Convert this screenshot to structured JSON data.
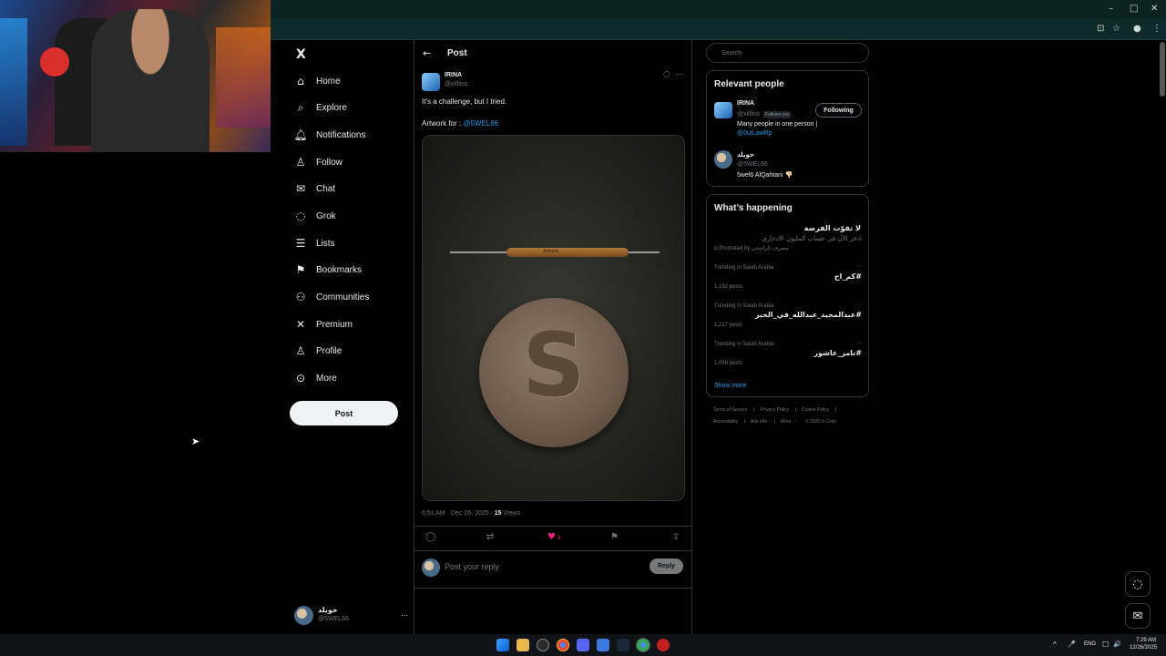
{
  "browser": {
    "window_controls": [
      "–",
      "□",
      "✕"
    ],
    "toolbar_icons": [
      "install-icon",
      "star-icon",
      "profile-icon",
      "menu-icon"
    ]
  },
  "webcam": {
    "logo_text": ""
  },
  "sidebar": {
    "logo": "X",
    "items": [
      {
        "label": "Home",
        "icon": "home-icon",
        "glyph": "⌂"
      },
      {
        "label": "Explore",
        "icon": "search-icon",
        "glyph": "⌕"
      },
      {
        "label": "Notifications",
        "icon": "bell-icon",
        "glyph": "♫"
      },
      {
        "label": "Follow",
        "icon": "add-person-icon",
        "glyph": "♙"
      },
      {
        "label": "Chat",
        "icon": "mail-icon",
        "glyph": "✉"
      },
      {
        "label": "Grok",
        "icon": "grok-icon",
        "glyph": "◌"
      },
      {
        "label": "Lists",
        "icon": "list-icon",
        "glyph": "☰"
      },
      {
        "label": "Bookmarks",
        "icon": "bookmark-icon",
        "glyph": "⚑"
      },
      {
        "label": "Communities",
        "icon": "communities-icon",
        "glyph": "⚇"
      },
      {
        "label": "Premium",
        "icon": "x-icon",
        "glyph": "✕"
      },
      {
        "label": "Profile",
        "icon": "person-icon",
        "glyph": "♙"
      },
      {
        "label": "More",
        "icon": "more-circle-icon",
        "glyph": "⊙"
      }
    ],
    "post_button": "Post",
    "account": {
      "name": "خويلد",
      "handle": "@5WEL66",
      "more": "···"
    }
  },
  "main": {
    "back_glyph": "←",
    "title": "Post",
    "tweet": {
      "author_name": "IRINA",
      "author_handle": "@xillliss",
      "grok_glyph": "◌",
      "more_glyph": "···",
      "text_line1": "It's a challenge, but I tried.",
      "text_line2_prefix": "Artwork for : ",
      "text_line2_mention": "@5WEL66",
      "image_stamp": "Artwork",
      "meta_time": "6:51 AM · Dec 26, 2025 · ",
      "meta_views_count": "15",
      "meta_views_label": " Views",
      "actions": {
        "reply": "◯",
        "retweet": "⇄",
        "like": "♥",
        "like_count": "2",
        "bookmark": "⚑",
        "share": "⇪"
      }
    },
    "reply": {
      "placeholder": "Post your reply",
      "button": "Reply"
    }
  },
  "right": {
    "search": {
      "placeholder": "Search",
      "glyph": "⌕"
    },
    "relevant": {
      "title": "Relevant people",
      "people": [
        {
          "name": "IRINA",
          "handle": "@xillliss",
          "badge": "Follows you",
          "bio": "Many people in one person |",
          "bio_link": "@0utLawRp",
          "button": "Following"
        },
        {
          "name": "خويلد",
          "handle": "@5WEL66",
          "bio": "5wel6 AlQahtani 👎🏻"
        }
      ]
    },
    "happening": {
      "title": "What’s happening",
      "promo": {
        "headline": "لا تفوّت الفرصة",
        "body": "ادخر الآن في حساب المليون الادخاري",
        "promoted": "Promoted by مصرف الراجحي"
      },
      "trends": [
        {
          "category": "Trending in Saudi Arabia",
          "tag": "#كم_اح",
          "count": "1,192 posts"
        },
        {
          "category": "Trending in Saudi Arabia",
          "tag": "#عبدالمجيد_عبدالله_في_الخبر",
          "count": "1,217 posts"
        },
        {
          "category": "Trending in Saudi Arabia",
          "tag": "#تامر_عاشور",
          "count": "1,059 posts"
        }
      ],
      "more_dots": "···",
      "show_more": "Show more"
    },
    "footer": {
      "row1": [
        "Terms of Service",
        "|",
        "Privacy Policy",
        "|",
        "Cookie Policy",
        "|"
      ],
      "row2": [
        "Accessibility",
        "|",
        "Ads info",
        "|",
        "More ···",
        "© 2025 X Corp."
      ]
    }
  },
  "fabs": {
    "grok": "◌",
    "messages": "✉"
  },
  "taskbar": {
    "lang": "ENG",
    "time": "7:29 AM",
    "date": "12/26/2025",
    "tray": [
      "^",
      "🎤",
      "☐",
      "🔊"
    ]
  }
}
